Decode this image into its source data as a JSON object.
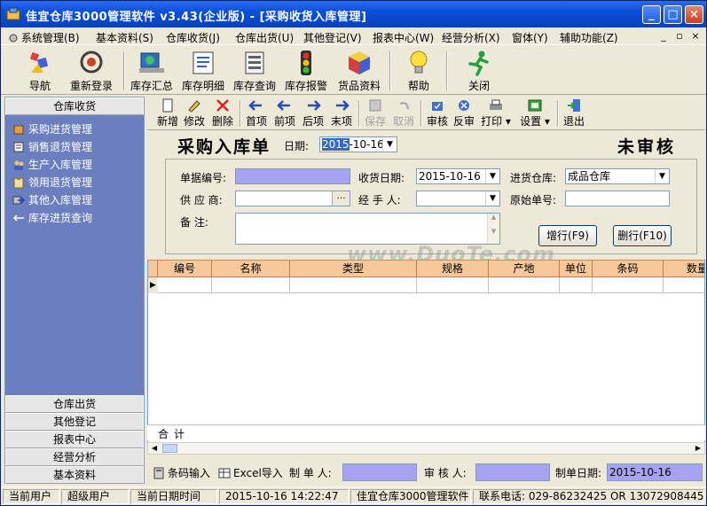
{
  "window": {
    "title": "佳宜仓库3000管理软件  v3.43(企业版)  - [采购收货入库管理]",
    "minimize": "_",
    "maximize": "□",
    "close": "×"
  },
  "menu": {
    "items": [
      "系统管理(B)",
      "基本资料(S)",
      "仓库收货(J)",
      "仓库出货(U)",
      "其他登记(V)",
      "报表中心(W)",
      "经营分析(X)",
      "窗体(Y)",
      "辅助功能(Z)"
    ],
    "mdi": [
      "_",
      "▫",
      "×"
    ]
  },
  "toolbar": {
    "buttons": [
      {
        "label": "导航",
        "icon": "navigation-icon"
      },
      {
        "label": "重新登录",
        "icon": "relogin-icon"
      },
      {
        "label": "库存汇总",
        "icon": "inventory-summary-icon"
      },
      {
        "label": "库存明细",
        "icon": "inventory-detail-icon"
      },
      {
        "label": "库存查询",
        "icon": "inventory-query-icon"
      },
      {
        "label": "库存报警",
        "icon": "traffic-light-icon"
      },
      {
        "label": "货品资料",
        "icon": "goods-icon"
      },
      {
        "label": "帮助",
        "icon": "lightbulb-icon"
      },
      {
        "label": "关闭",
        "icon": "running-man-icon"
      }
    ]
  },
  "nav": {
    "header": "仓库收货",
    "items": [
      "采购进货管理",
      "销售退货管理",
      "生产入库管理",
      "领用退货管理",
      "其他入库管理",
      "库存进货查询"
    ],
    "footer": [
      "仓库出货",
      "其他登记",
      "报表中心",
      "经营分析",
      "基本资料"
    ]
  },
  "subtoolbar": {
    "new": "新增",
    "edit": "修改",
    "delete": "删除",
    "first": "首项",
    "prev": "前项",
    "next": "后项",
    "last": "末项",
    "save": "保存",
    "cancel": "取消",
    "audit": "审核",
    "unaudit": "反审",
    "print": "打印",
    "settings": "设置",
    "exit": "退出"
  },
  "form": {
    "title": "采购入库单",
    "date_label": "日期:",
    "date_value_sel": "2015",
    "date_value_rest": "-10-16",
    "status": "未审核",
    "doc_no_label": "单据编号:",
    "receive_date_label": "收货日期:",
    "receive_date_value": "2015-10-16",
    "warehouse_label": "进货仓库:",
    "warehouse_value": "成品仓库",
    "supplier_label": "供 应 商:",
    "handler_label": "经 手 人:",
    "orig_no_label": "原始单号:",
    "remark_label": "备    注:",
    "add_row_button": "增行(F9)",
    "del_row_button": "删行(F10)"
  },
  "watermark": "www.DuoTe.com",
  "grid": {
    "columns": [
      "编号",
      "名称",
      "类型",
      "规格",
      "产地",
      "单位",
      "条码",
      "数量"
    ],
    "total_label": "合计"
  },
  "bottom": {
    "barcode": "条码输入",
    "excel": "Excel导入",
    "maker_label": "制 单 人:",
    "auditor_label": "审 核 人:",
    "make_date_label": "制单日期:",
    "make_date_value": "2015-10-16"
  },
  "statusbar": {
    "current_user_label": "当前用户",
    "current_user": "超级用户",
    "current_date_label": "当前日期时间",
    "datetime": "2015-10-16 14:22:47",
    "product": "佳宜仓库3000管理软件",
    "phone": "联系电话: 029-86232425  OR  13072908445"
  },
  "colors": {
    "titlebar": "#0a50d8",
    "nav_bg": "#6b7fc0",
    "grid_header": "#f6c89a",
    "purple_field": "#a8a3f0"
  }
}
